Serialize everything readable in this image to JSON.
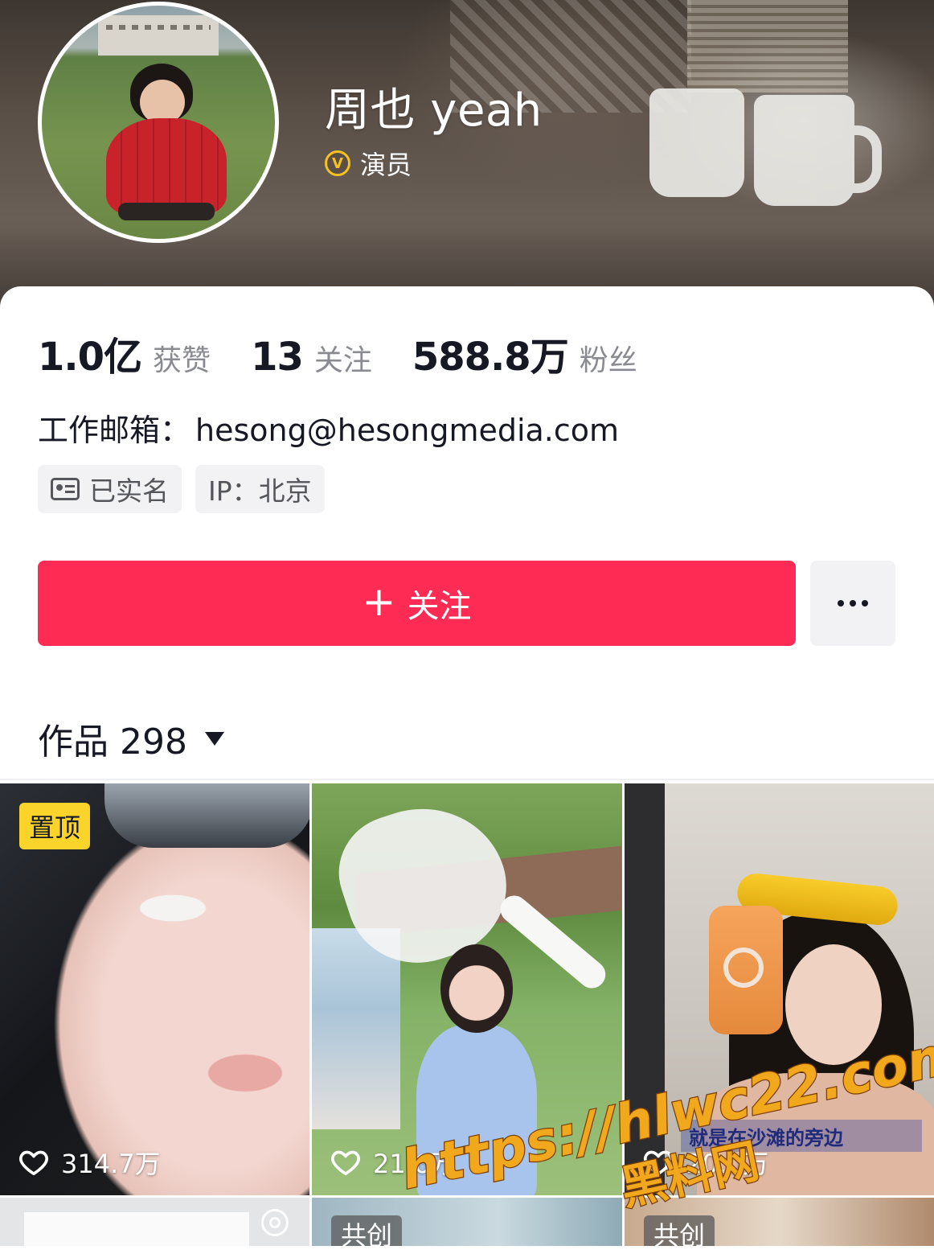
{
  "profile": {
    "name": "周也 yeah",
    "verified_label": "演员",
    "verified_icon": "verified-v-icon",
    "avatar_icon": "avatar-photo"
  },
  "stats": [
    {
      "value": "1.0亿",
      "label": "获赞"
    },
    {
      "value": "13",
      "label": "关注"
    },
    {
      "value": "588.8万",
      "label": "粉丝"
    }
  ],
  "contact": {
    "email_label": "工作邮箱：",
    "email_value": "hesong@hesongmedia.com"
  },
  "tags": {
    "real_name": "已实名",
    "real_name_icon": "id-card-icon",
    "ip": "IP：北京"
  },
  "actions": {
    "follow_label": "关注",
    "follow_icon": "plus-icon",
    "more_icon": "more-dots-icon"
  },
  "works_tab": {
    "label": "作品 298",
    "dropdown_icon": "caret-down-icon"
  },
  "videos": [
    {
      "badge": "置顶",
      "likes": "314.7万"
    },
    {
      "badge": "",
      "likes": "21.6万"
    },
    {
      "badge": "",
      "likes": "20.0万",
      "caption": "就是在沙滩的旁边"
    },
    {
      "badge": "",
      "likes": ""
    },
    {
      "badge": "共创",
      "likes": ""
    },
    {
      "badge": "共创",
      "likes": ""
    }
  ],
  "watermark": {
    "url": "https://hlwc22.com",
    "site": "黑料网"
  },
  "colors": {
    "accent": "#fe2c55",
    "pin_badge": "#fad42b",
    "verified": "#f7c21f",
    "watermark": "#f2a81c"
  }
}
